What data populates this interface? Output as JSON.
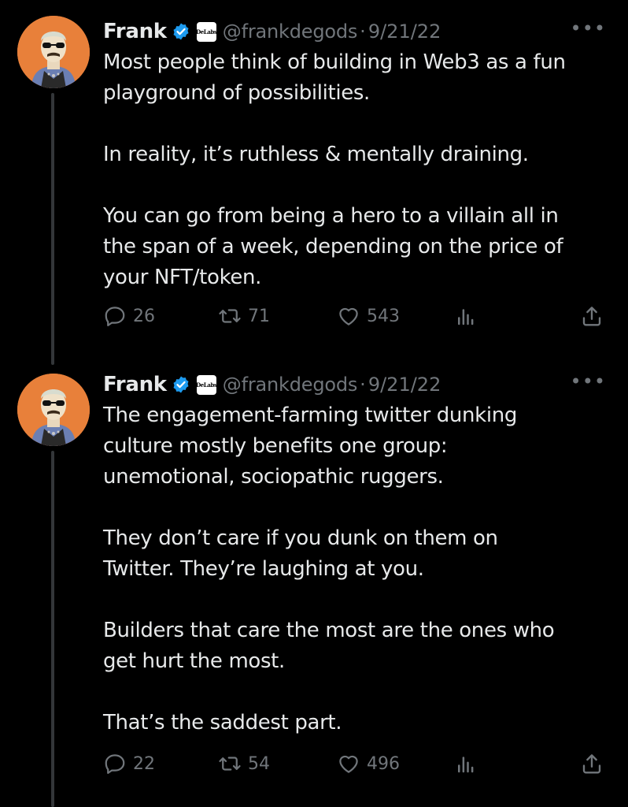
{
  "tweets": [
    {
      "name": "Frank",
      "affiliation_badge": "DeLabs",
      "handle": "@frankdegods",
      "separator": "·",
      "date": "9/21/22",
      "more_icon": "more-horizontal-icon",
      "paragraphs": [
        [
          "Most people think of building in Web3 as a fun",
          "playground of possibilities."
        ],
        [
          "In reality, it’s ruthless & mentally draining."
        ],
        [
          "You can go from being a hero to a villain all in",
          "the span of a week, depending on the price of",
          "your NFT/token."
        ]
      ],
      "replies": "26",
      "retweets": "71",
      "likes": "543"
    },
    {
      "name": "Frank",
      "affiliation_badge": "DeLabs",
      "handle": "@frankdegods",
      "separator": "·",
      "date": "9/21/22",
      "more_icon": "more-horizontal-icon",
      "paragraphs": [
        [
          "The engagement-farming twitter dunking",
          "culture mostly benefits one group:",
          "unemotional, sociopathic ruggers."
        ],
        [
          "They don’t care if you dunk on them on",
          "Twitter. They’re laughing at you."
        ],
        [
          "Builders that care the most are the ones who",
          "get hurt the most."
        ],
        [
          "That’s the saddest part."
        ]
      ],
      "replies": "22",
      "retweets": "54",
      "likes": "496"
    }
  ],
  "colors": {
    "background": "#000000",
    "text": "#e7e9ea",
    "muted": "#71767b",
    "verified": "#1d9bf0",
    "avatar_bg": "#e8803a"
  }
}
